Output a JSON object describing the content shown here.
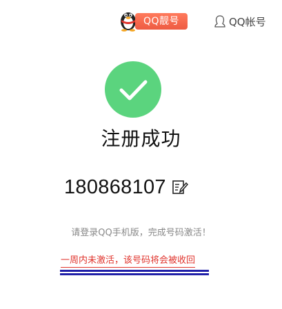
{
  "header": {
    "pretty_number_label": "QQ靓号",
    "account_label": "QQ帐号",
    "penguin_icon": "qq-penguin-icon",
    "user_icon": "user-outline-icon"
  },
  "success": {
    "title": "注册成功",
    "qq_number": "180868107",
    "edit_icon": "edit-icon",
    "hint": "请登录QQ手机版，完成号码激活！",
    "warning": "一周内未激活，该号码将会被收回"
  },
  "colors": {
    "success_green": "#5bd47e",
    "pretty_button": "#ee5b42",
    "warning_red": "#e0332c",
    "annotation_blue": "#1f1fa8",
    "hint_gray": "#888888"
  }
}
